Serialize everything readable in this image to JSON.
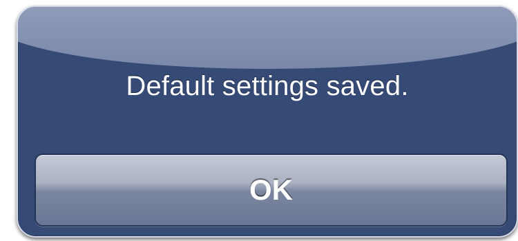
{
  "alert": {
    "message": "Default settings saved.",
    "ok_label": "OK"
  },
  "colors": {
    "panel": "#364a76",
    "gloss": "#9aa7c2",
    "button": "#8f98ad",
    "text": "#ffffff"
  }
}
